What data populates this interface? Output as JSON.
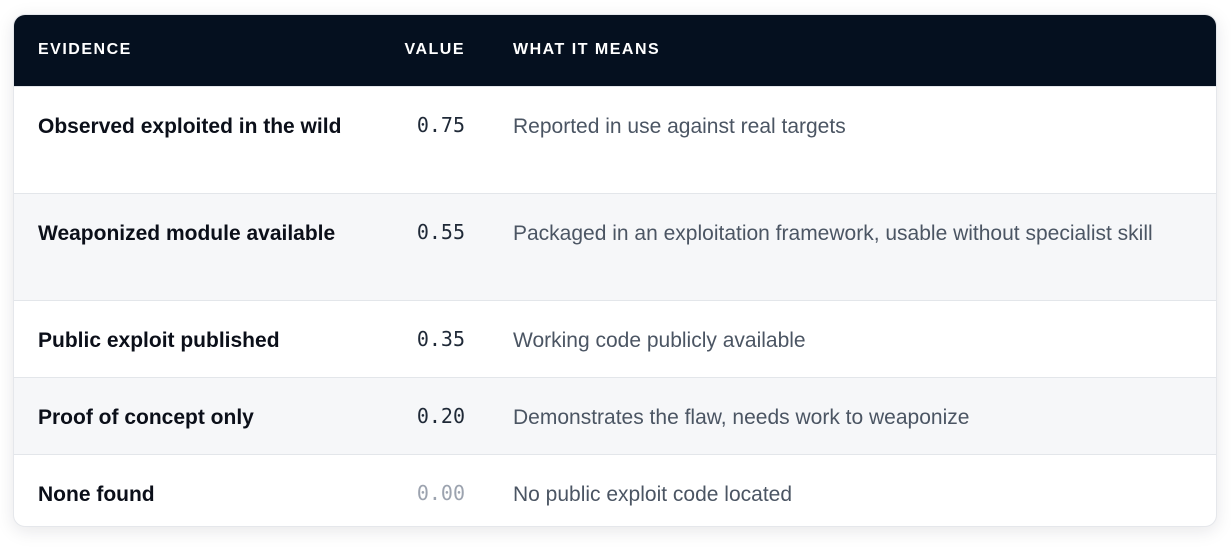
{
  "table": {
    "headers": {
      "evidence": "EVIDENCE",
      "value": "VALUE",
      "meaning": "WHAT IT MEANS"
    },
    "rows": [
      {
        "evidence": "Observed exploited in the wild",
        "value": "0.75",
        "meaning": "Reported in use against real targets"
      },
      {
        "evidence": "Weaponized module available",
        "value": "0.55",
        "meaning": "Packaged in an exploitation framework, usable without specialist skill"
      },
      {
        "evidence": "Public exploit published",
        "value": "0.35",
        "meaning": "Working code publicly available"
      },
      {
        "evidence": "Proof of concept only",
        "value": "0.20",
        "meaning": "Demonstrates the flaw, needs work to weaponize"
      },
      {
        "evidence": "None found",
        "value": "0.00",
        "meaning": "No public exploit code located"
      }
    ]
  },
  "colors": {
    "header_bg": "#05101f",
    "row_alt_bg": "#f6f7f9",
    "muted_value": "#9ca3af"
  }
}
